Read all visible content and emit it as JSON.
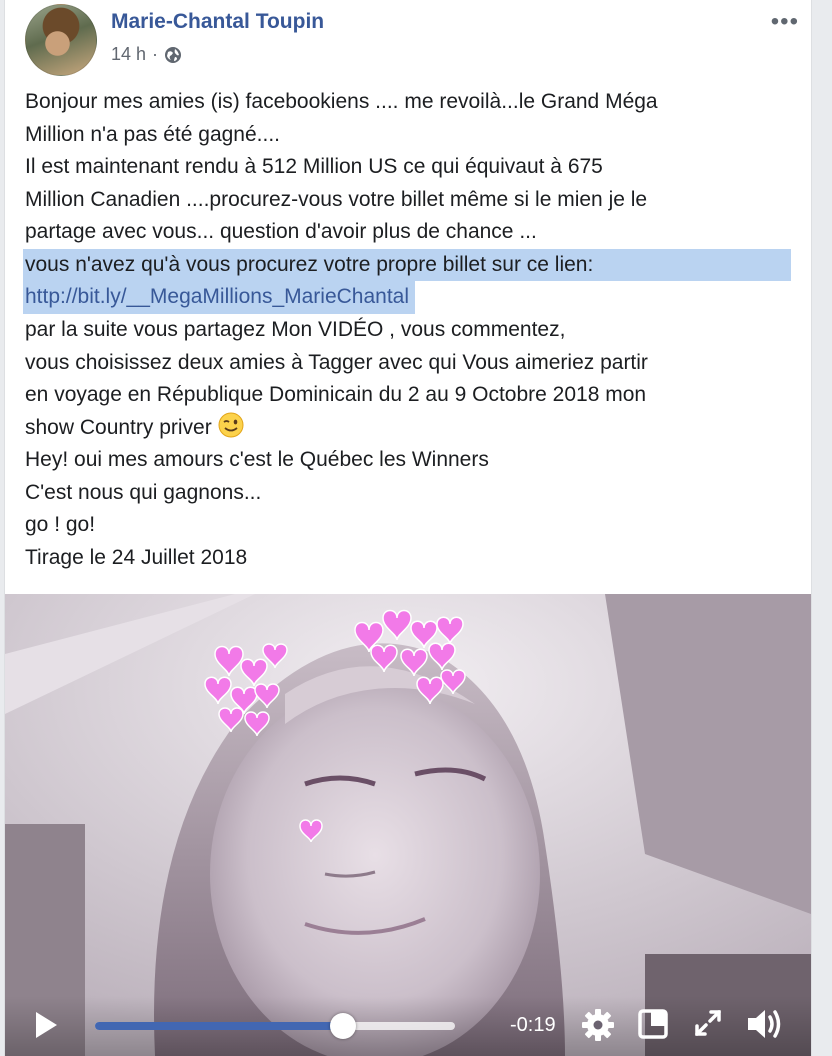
{
  "post": {
    "author": "Marie-Chantal Toupin",
    "time": "14 h",
    "separator": "·",
    "more_label": "•••"
  },
  "body": {
    "lines": [
      "Bonjour mes amies (is) facebookiens .... me revoilà...le Grand Méga",
      "Million n'a pas été gagné....",
      "Il est maintenant rendu à 512 Million US ce qui équivaut à 675",
      "Million Canadien ....procurez-vous votre billet même si le mien je le",
      "partage avec vous... question d'avoir plus de chance ...",
      "vous n'avez qu'à vous procurez votre propre billet sur ce lien:"
    ],
    "link": "http://bit.ly/__MegaMillions_MarieChantal",
    "lines2": [
      "par la suite vous partagez Mon VIDÉO , vous commentez,",
      "vous choisissez deux amies à Tagger avec qui Vous aimeriez partir",
      "en voyage en République Dominicain du 2 au 9 Octobre 2018 mon",
      "show Country priver",
      "Hey! oui mes amours c'est le Québec les Winners",
      "C'est nous qui gagnons...",
      "go ! go!",
      "Tirage le 24 Juillet 2018"
    ]
  },
  "video": {
    "time_remaining": "-0:19",
    "progress": 0.69
  },
  "colors": {
    "link": "#385898",
    "highlight": "#bad3f1",
    "hearts": "#f27ae8",
    "progress": "#4267b2"
  }
}
